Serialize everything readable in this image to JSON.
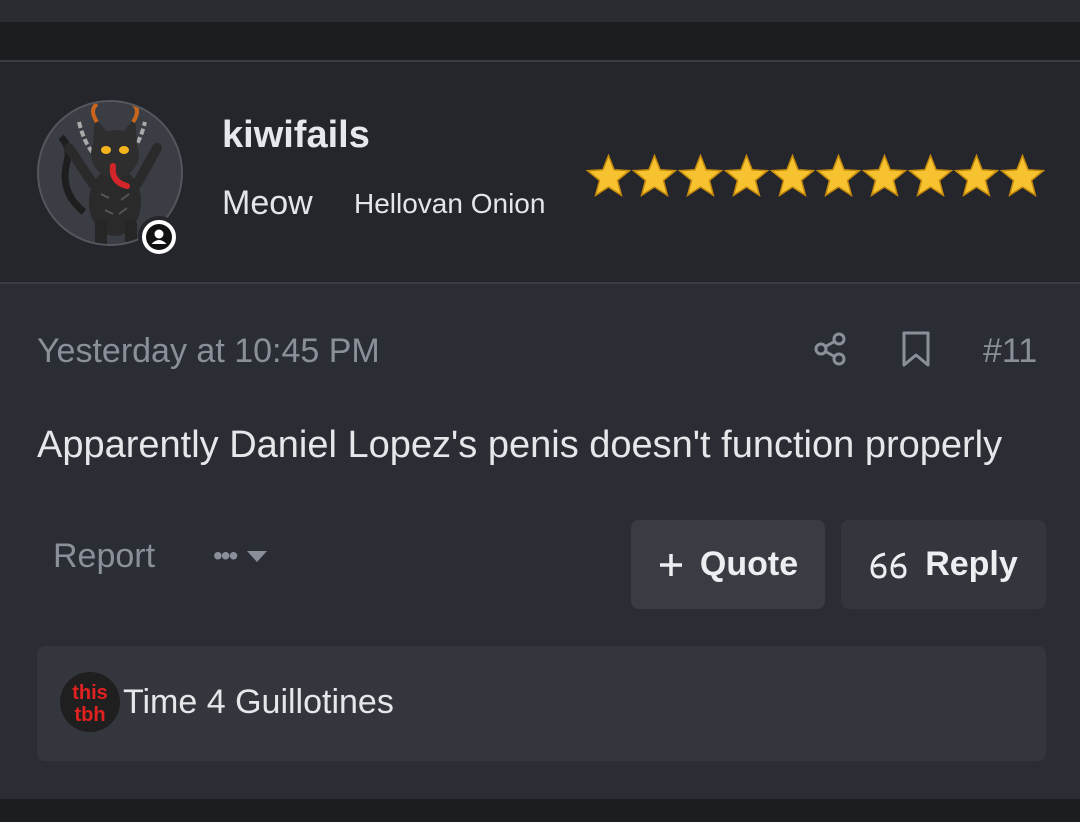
{
  "header": {
    "username": "kiwifails",
    "user_title": "Meow",
    "user_banner": "Hellovan Onion",
    "star_count": 10,
    "star_color": "#f6c230"
  },
  "post": {
    "timestamp": "Yesterday at 10:45 PM",
    "post_number": "#11",
    "message": "Apparently Daniel Lopez's penis doesn't function properly",
    "report_label": "Report",
    "more_label": "•••",
    "quote_label": "Quote",
    "reply_label": "Reply"
  },
  "reactions": {
    "icon_text_top": "this",
    "icon_text_bottom": "tbh",
    "summary": "Time 4 Guillotines"
  },
  "colors": {
    "background": "#2b2d34",
    "header_bg": "#25262c",
    "muted_text": "#8b8f99",
    "button_bg": "#3a3c43",
    "reaction_red": "#e0211f"
  }
}
